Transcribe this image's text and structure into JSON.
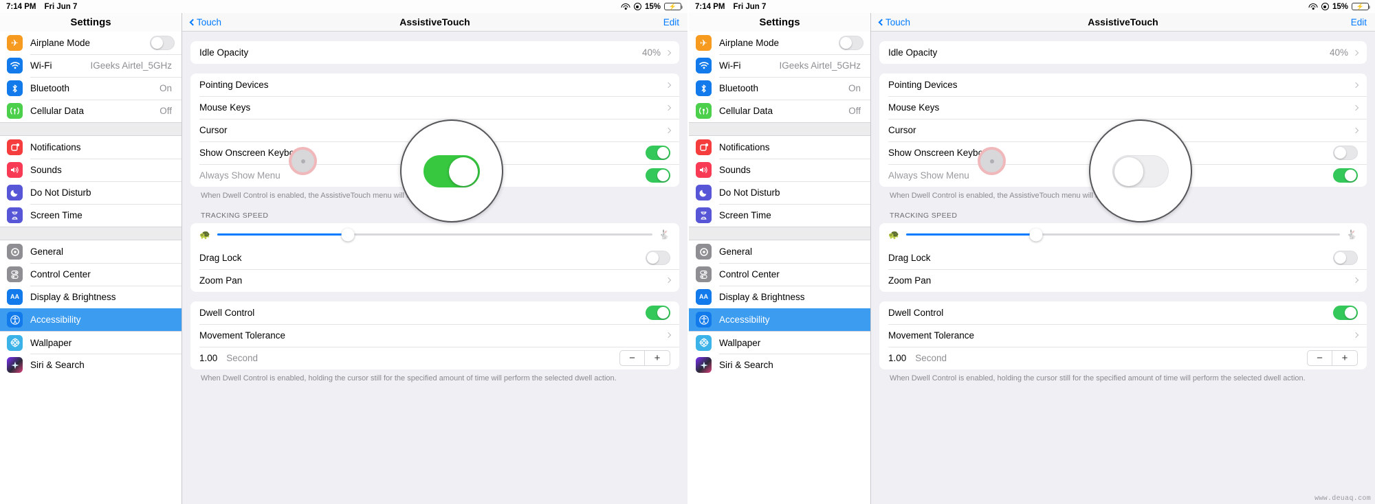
{
  "status_bar": {
    "time": "7:14 PM",
    "date": "Fri Jun 7",
    "battery_percent": "15%",
    "wifi_icon": "wifi-icon",
    "location_icon": "location-icon",
    "battery_icon": "battery-charging-icon"
  },
  "sidebar": {
    "title": "Settings",
    "groups": [
      {
        "items": [
          {
            "label": "Airplane Mode",
            "icon": "airplane-icon",
            "icon_color": "#f79a20",
            "control": "toggle",
            "toggle_on": false
          },
          {
            "label": "Wi-Fi",
            "icon": "wifi-icon",
            "icon_color": "#127aeb",
            "value": "IGeeks Airtel_5GHz"
          },
          {
            "label": "Bluetooth",
            "icon": "bluetooth-icon",
            "icon_color": "#127aeb",
            "value": "On"
          },
          {
            "label": "Cellular Data",
            "icon": "cellular-icon",
            "icon_color": "#4cd04c",
            "value": "Off"
          }
        ]
      },
      {
        "items": [
          {
            "label": "Notifications",
            "icon": "notifications-icon",
            "icon_color": "#f53d3d"
          },
          {
            "label": "Sounds",
            "icon": "sounds-icon",
            "icon_color": "#f93a55"
          },
          {
            "label": "Do Not Disturb",
            "icon": "moon-icon",
            "icon_color": "#5756d6"
          },
          {
            "label": "Screen Time",
            "icon": "hourglass-icon",
            "icon_color": "#5756d6"
          }
        ]
      },
      {
        "items": [
          {
            "label": "General",
            "icon": "gear-icon",
            "icon_color": "#8e8e93"
          },
          {
            "label": "Control Center",
            "icon": "control-center-icon",
            "icon_color": "#8e8e93"
          },
          {
            "label": "Display & Brightness",
            "icon": "display-brightness-icon",
            "icon_color": "#127aeb",
            "icon_text": "AA"
          },
          {
            "label": "Accessibility",
            "icon": "accessibility-icon",
            "icon_color": "#127aeb",
            "selected": true
          }
        ]
      },
      {
        "items": [
          {
            "label": "Wallpaper",
            "icon": "wallpaper-icon",
            "icon_color": "#3cb3e8"
          },
          {
            "label": "Siri & Search",
            "icon": "siri-icon",
            "icon_color": "#2b2b3a"
          }
        ]
      }
    ]
  },
  "detail": {
    "back_label": "Touch",
    "title": "AssistiveTouch",
    "edit_label": "Edit",
    "idle_opacity": {
      "label": "Idle Opacity",
      "value": "40%"
    },
    "pointer_group": [
      {
        "label": "Pointing Devices",
        "accessory": "chevron"
      },
      {
        "label": "Mouse Keys",
        "accessory": "chevron"
      },
      {
        "label": "Cursor",
        "accessory": "chevron"
      },
      {
        "label": "Show Onscreen Keyboard",
        "accessory": "toggle"
      },
      {
        "label": "Always Show Menu",
        "accessory": "toggle",
        "dim": true
      }
    ],
    "pointer_footer": "When Dwell Control is enabled, the AssistiveTouch menu will always be visible.",
    "tracking_header": "TRACKING SPEED",
    "tracking_speed": {
      "turtle_icon": "turtle-icon",
      "hare_icon": "hare-icon",
      "value_percent": 30
    },
    "drag_lock": {
      "label": "Drag Lock",
      "toggle_on": false
    },
    "zoom_pan": {
      "label": "Zoom Pan",
      "accessory": "chevron"
    },
    "dwell_control": {
      "label": "Dwell Control",
      "toggle_on": true
    },
    "movement_tolerance": {
      "label": "Movement Tolerance",
      "accessory": "chevron"
    },
    "dwell_time": {
      "value": "1.00",
      "unit": "Second",
      "minus": "−",
      "plus": "+"
    },
    "dwell_footer": "When Dwell Control is enabled, holding the cursor still for the specified amount of time will perform the selected dwell action."
  },
  "panels": [
    {
      "id": "left",
      "magnified_toggle_state": "on"
    },
    {
      "id": "right",
      "magnified_toggle_state": "off"
    }
  ],
  "watermark": "www.deuaq.com"
}
